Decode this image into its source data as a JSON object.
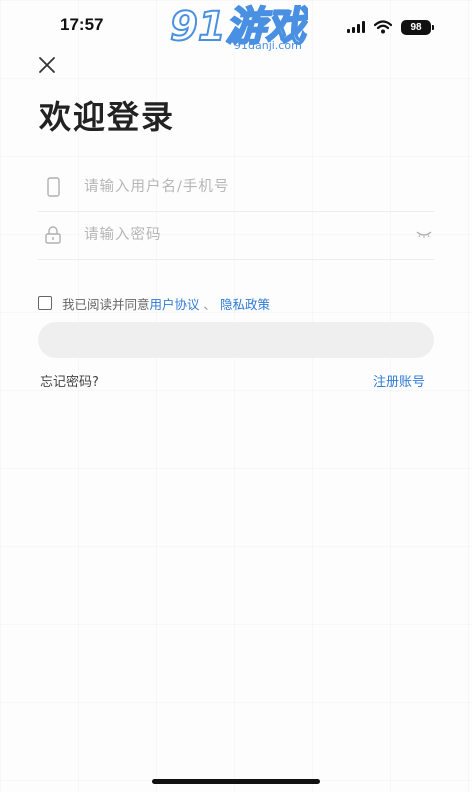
{
  "status_bar": {
    "time": "17:57",
    "battery": "98"
  },
  "watermark": {
    "logo_text": "91游戏",
    "site": "91danji.com"
  },
  "header": {
    "title": "欢迎登录"
  },
  "form": {
    "username_placeholder": "请输入用户名/手机号",
    "password_placeholder": "请输入密码"
  },
  "agreement": {
    "prefix": "我已阅读并同意",
    "user_agreement": "用户协议",
    "separator": "、",
    "privacy_policy": "隐私政策"
  },
  "login_button": {
    "label": ""
  },
  "links": {
    "forgot_password": "忘记密码?",
    "register": "注册账号"
  },
  "colors": {
    "link": "#2f7bd6",
    "watermark": "#4a90e2",
    "button": "#efefef"
  }
}
